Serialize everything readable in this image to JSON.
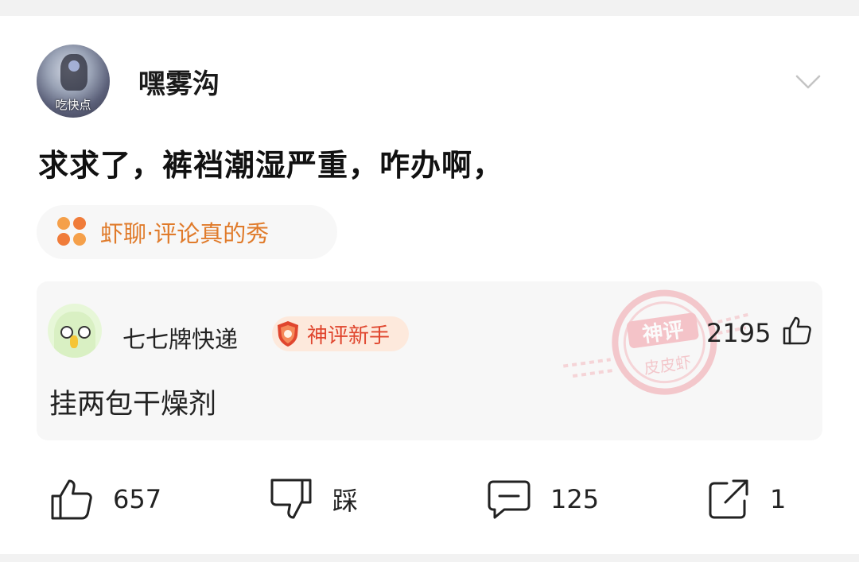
{
  "post": {
    "user": {
      "name": "嘿雾沟",
      "avatar_tag": "吃快点"
    },
    "title": "求求了，裤裆潮湿严重，咋办啊，",
    "topic": {
      "label": "虾聊·评论真的秀",
      "icon": "four-dots-icon",
      "colors": [
        "#f5a04a",
        "#f07c3a",
        "#f07c3a",
        "#f5a04a"
      ]
    }
  },
  "top_comment": {
    "user": "七七牌快递",
    "badge": "神评新手",
    "likes": "2195",
    "text": "挂两包干燥剂",
    "stamp": {
      "line1": "神评",
      "line2": "皮皮虾"
    }
  },
  "actions": {
    "like": "657",
    "dislike": "踩",
    "comment": "125",
    "share": "1"
  },
  "colors": {
    "accent_orange": "#e07b2b",
    "badge_red": "#e0462e",
    "stamp_pink": "#f0a0a8"
  }
}
